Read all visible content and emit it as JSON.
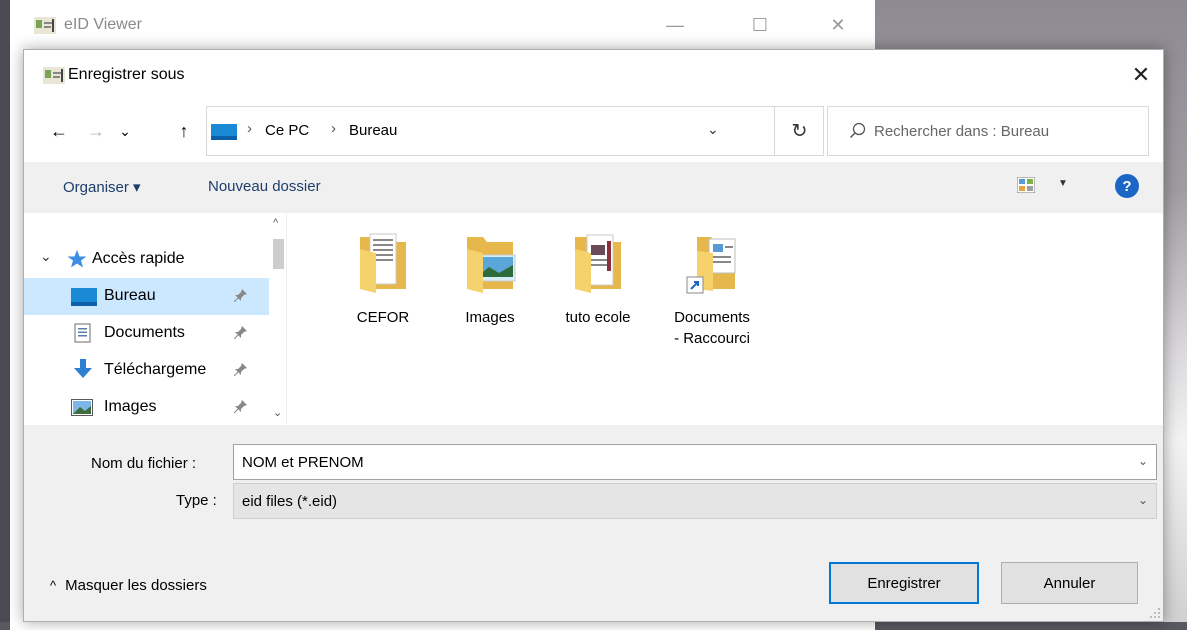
{
  "parent_window": {
    "title": "eID Viewer",
    "minimize_glyph": "—",
    "maximize_glyph": "☐",
    "close_glyph": "✕"
  },
  "dialog": {
    "title": "Enregistrer sous",
    "close_glyph": "✕"
  },
  "navbar": {
    "back_glyph": "←",
    "forward_glyph": "→",
    "recent_glyph": "⌄",
    "up_glyph": "↑",
    "breadcrumb": [
      "Ce PC",
      "Bureau"
    ],
    "separator": "›",
    "dropdown_glyph": "⌄",
    "refresh_glyph": "↻",
    "search_placeholder": "Rechercher dans : Bureau"
  },
  "toolbar": {
    "organize_label": "Organiser ▾",
    "new_folder_label": "Nouveau dossier",
    "view_dropdown_glyph": "▼",
    "help_glyph": "?"
  },
  "navpane": {
    "expand_glyph": "⌄",
    "quick_access_label": "Accès rapide",
    "scroll_up_glyph": "^",
    "scroll_down_glyph": "⌄",
    "items": [
      {
        "label": "Bureau",
        "icon": "desktop-icon",
        "pinned": true,
        "selected": true
      },
      {
        "label": "Documents",
        "icon": "documents-icon",
        "pinned": true,
        "selected": false
      },
      {
        "label": "Téléchargeme",
        "icon": "download-icon",
        "pinned": true,
        "selected": false
      },
      {
        "label": "Images",
        "icon": "images-icon",
        "pinned": true,
        "selected": false
      }
    ]
  },
  "files": [
    {
      "label": "CEFOR",
      "icon": "folder-icon"
    },
    {
      "label": "Images",
      "icon": "folder-images-icon"
    },
    {
      "label": "tuto ecole",
      "icon": "folder-icon"
    },
    {
      "label": "Documents",
      "label_line2": "- Raccourci",
      "icon": "shortcut-icon"
    }
  ],
  "form": {
    "filename_label": "Nom du fichier :",
    "filename_value": "NOM et PRENOM",
    "type_label": "Type :",
    "type_value": "eid files (*.eid)",
    "dropdown_glyph": "⌄"
  },
  "footer": {
    "hide_folders_glyph": "^",
    "hide_folders_label": "Masquer les dossiers",
    "save_label": "Enregistrer",
    "cancel_label": "Annuler"
  },
  "colors": {
    "accent": "#0078d7",
    "selection": "#cce8ff",
    "link_text": "#1e3d6b",
    "help": "#1b65c4",
    "folder": "#f5d26b"
  }
}
